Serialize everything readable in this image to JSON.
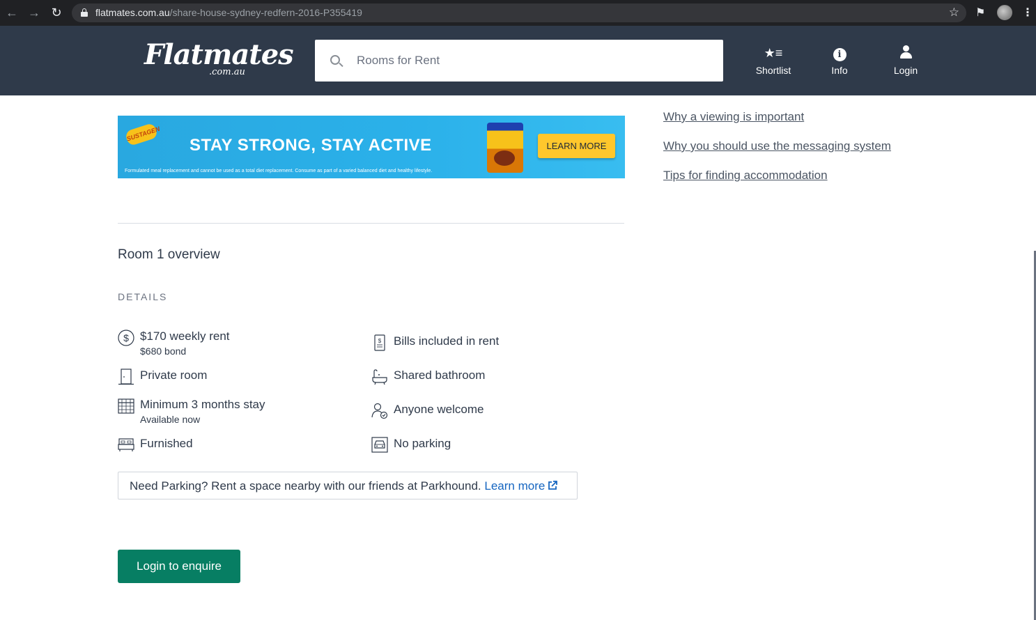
{
  "browser": {
    "url_domain": "flatmates.com.au",
    "url_path": "/share-house-sydney-redfern-2016-P355419"
  },
  "header": {
    "logo_main": "Flatmates",
    "logo_sub": ".com.au",
    "search_placeholder": "Rooms for Rent",
    "nav": [
      {
        "label": "Shortlist",
        "icon": "shortlist-star-icon"
      },
      {
        "label": "Info",
        "icon": "info-icon"
      },
      {
        "label": "Login",
        "icon": "user-icon"
      }
    ]
  },
  "ad": {
    "brand": "SUSTAGEN",
    "headline": "STAY STRONG, STAY ACTIVE",
    "fine_print": "Formulated meal replacement and cannot be used as a total diet replacement. Consume as part of a varied balanced diet and healthy lifestyle.",
    "button": "LEARN MORE"
  },
  "sidebar": {
    "links": [
      "Why a viewing is important",
      "Why you should use the messaging system",
      "Tips for finding accommodation"
    ]
  },
  "room": {
    "title": "Room 1 overview",
    "details_label": "DETAILS",
    "features_left": [
      {
        "title": "$170 weekly rent",
        "sub": "$680 bond",
        "icon": "dollar-icon"
      },
      {
        "title": "Private room",
        "sub": "",
        "icon": "door-icon"
      },
      {
        "title": "Minimum 3 months stay",
        "sub": "Available now",
        "icon": "calendar-icon"
      },
      {
        "title": "Furnished",
        "sub": "",
        "icon": "bed-icon"
      }
    ],
    "features_right": [
      {
        "title": "Bills included in rent",
        "icon": "bill-icon"
      },
      {
        "title": "Shared bathroom",
        "icon": "bath-icon"
      },
      {
        "title": "Anyone welcome",
        "icon": "person-check-icon"
      },
      {
        "title": "No parking",
        "icon": "car-icon"
      }
    ]
  },
  "parking": {
    "text": "Need Parking? Rent a space nearby with our friends at Parkhound.",
    "link": "Learn more"
  },
  "cta": {
    "enquire": "Login to enquire"
  },
  "colors": {
    "header_bg": "#2f3a4a",
    "cta_green": "#077e63",
    "link_blue": "#1565c0"
  }
}
